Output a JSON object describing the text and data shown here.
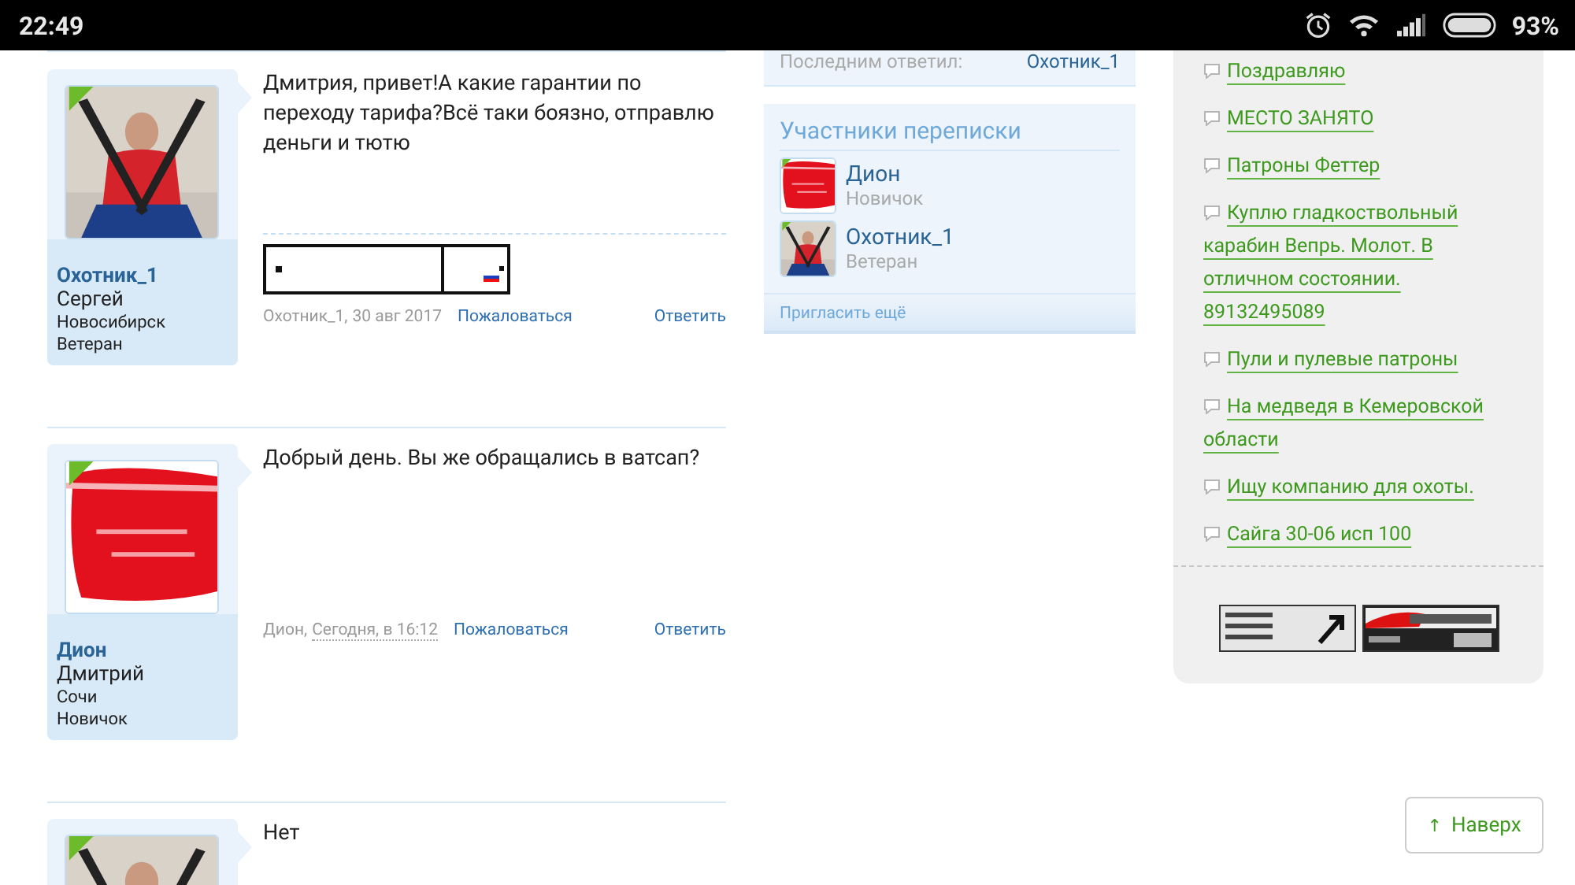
{
  "status_bar": {
    "time": "22:49",
    "battery": "93%"
  },
  "posts": [
    {
      "username": "Охотник_1",
      "real_name": "Сергей",
      "city": "Новосибирск",
      "rank": "Ветеран",
      "avatar": {
        "kind": "person"
      },
      "message": "Дмитрия, привет!А какие гарантии по переходу тарифа?Всё таки боязно, отправлю деньги и тютю",
      "author": "Охотник_1,",
      "date": "30 авг 2017",
      "date_dotted": false,
      "report": "Пожаловаться",
      "reply": "Ответить"
    },
    {
      "username": "Дион",
      "real_name": "Дмитрий",
      "city": "Сочи",
      "rank": "Новичок",
      "avatar": {
        "kind": "banner"
      },
      "message": "Добрый день. Вы же обращались в ватсап?",
      "author": "Дион,",
      "date": "Сегодня, в 16:12",
      "date_dotted": true,
      "report": "Пожаловаться",
      "reply": "Ответить"
    },
    {
      "avatar": {
        "kind": "person"
      },
      "message": "Нет"
    }
  ],
  "last_reply": {
    "label": "Последним ответил:",
    "user": "Охотник_1"
  },
  "participants": {
    "title": "Участники переписки",
    "members": [
      {
        "name": "Дион",
        "rank": "Новичок",
        "avatar": {
          "kind": "banner"
        }
      },
      {
        "name": "Охотник_1",
        "rank": "Ветеран",
        "avatar": {
          "kind": "person"
        }
      }
    ],
    "invite": "Пригласить ещё"
  },
  "topics": [
    "Поздравляю",
    "МЕСТО ЗАНЯТО",
    "Патроны Феттер",
    "Куплю гладкоствольный карабин Вепрь. Молот. В отличном состоянии. 89132495089",
    "Пули и пулевые патроны",
    "На медведя в Кемеровской области",
    "Ищу компанию для охоты.",
    "Сайга 30-06 исп 100"
  ],
  "scroll_top": {
    "arrow": "↑",
    "label": "Наверх"
  }
}
